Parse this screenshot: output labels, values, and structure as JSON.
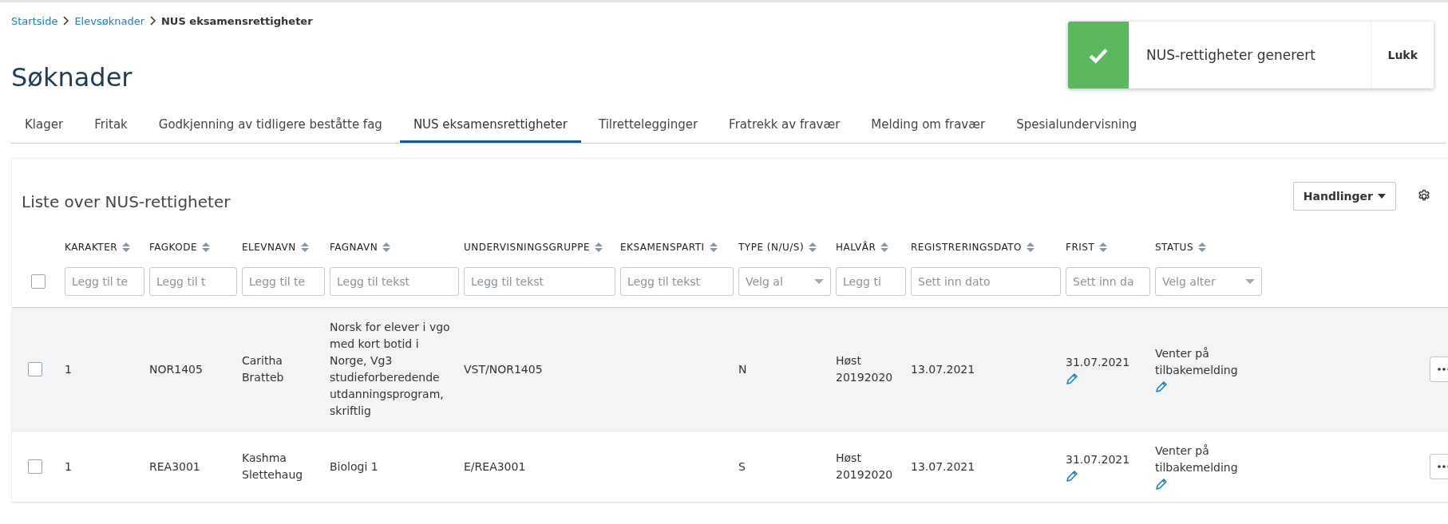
{
  "breadcrumbs": [
    {
      "label": "Startside",
      "kind": "link"
    },
    {
      "label": "Elevsøknader",
      "kind": "link"
    },
    {
      "label": "NUS eksamensrettigheter",
      "kind": "current"
    }
  ],
  "title": "Søknader",
  "tabs": [
    {
      "label": "Klager",
      "selected": false
    },
    {
      "label": "Fritak",
      "selected": false
    },
    {
      "label": "Godkjenning av tidligere beståtte fag",
      "selected": false
    },
    {
      "label": "NUS eksamensrettigheter",
      "selected": true
    },
    {
      "label": "Tilrettelegginger",
      "selected": false
    },
    {
      "label": "Fratrekk av fravær",
      "selected": false
    },
    {
      "label": "Melding om fravær",
      "selected": false
    },
    {
      "label": "Spesialundervisning",
      "selected": false
    }
  ],
  "toast": {
    "message": "NUS-rettigheter generert",
    "close_label": "Lukk"
  },
  "card": {
    "title": "Liste over NUS-rettigheter",
    "actions_button": "Handlinger"
  },
  "table": {
    "select_all_checked": false,
    "columns": [
      {
        "label": "KARAKTER",
        "filter": {
          "kind": "text",
          "placeholder": "Legg til te"
        }
      },
      {
        "label": "FAGKODE",
        "filter": {
          "kind": "text",
          "placeholder": "Legg til t"
        }
      },
      {
        "label": "ELEVNAVN",
        "filter": {
          "kind": "text",
          "placeholder": "Legg til te"
        }
      },
      {
        "label": "FAGNAVN",
        "filter": {
          "kind": "text",
          "placeholder": "Legg til tekst"
        }
      },
      {
        "label": "UNDERVISNINGSGRUPPE",
        "filter": {
          "kind": "text",
          "placeholder": "Legg til tekst"
        }
      },
      {
        "label": "EKSAMENSPARTI",
        "filter": {
          "kind": "text",
          "placeholder": "Legg til tekst"
        }
      },
      {
        "label": "TYPE (N/U/S)",
        "filter": {
          "kind": "select",
          "placeholder": "Velg al"
        }
      },
      {
        "label": "HALVÅR",
        "filter": {
          "kind": "text",
          "placeholder": "Legg ti"
        }
      },
      {
        "label": "REGISTRERINGSDATO",
        "filter": {
          "kind": "date",
          "placeholder": "Sett inn dato"
        }
      },
      {
        "label": "FRIST",
        "filter": {
          "kind": "date",
          "placeholder": "Sett inn da"
        }
      },
      {
        "label": "STATUS",
        "filter": {
          "kind": "select",
          "placeholder": "Velg alter"
        }
      }
    ],
    "rows": [
      {
        "checked": false,
        "highlighted": true,
        "cells": [
          {
            "text": "1"
          },
          {
            "text": "NOR1405"
          },
          {
            "text": "Caritha Bratteb"
          },
          {
            "text": "Norsk for elever i vgo med kort botid i Norge, Vg3 studieforberedende utdanningsprogram, skriftlig"
          },
          {
            "text": "VST/NOR1405"
          },
          {},
          {
            "text": "N"
          },
          {
            "text": "Høst 20192020"
          },
          {
            "text": "13.07.2021"
          },
          {
            "text": "31.07.2021",
            "editable": true
          },
          {
            "text": "Venter på tilbakemelding",
            "editable": true
          }
        ]
      },
      {
        "checked": false,
        "highlighted": false,
        "cells": [
          {
            "text": "1"
          },
          {
            "text": "REA3001"
          },
          {
            "text": "Kashma Slettehaug"
          },
          {
            "text": "Biologi 1"
          },
          {
            "text": "E/REA3001"
          },
          {},
          {
            "text": "S"
          },
          {
            "text": "Høst 20192020"
          },
          {
            "text": "13.07.2021"
          },
          {
            "text": "31.07.2021",
            "editable": true
          },
          {
            "text": "Venter på tilbakemelding",
            "editable": true
          }
        ]
      }
    ]
  }
}
